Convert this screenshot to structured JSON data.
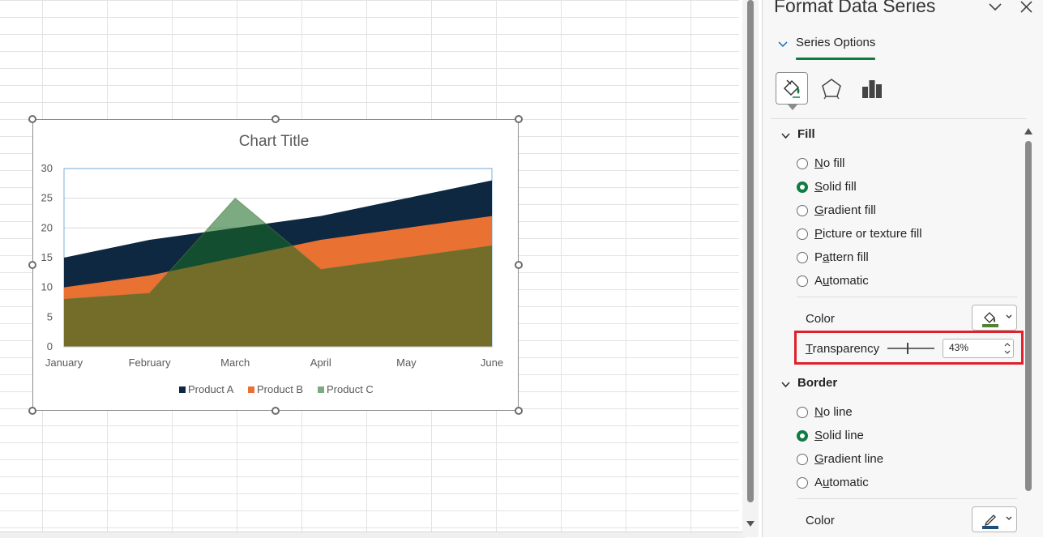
{
  "pane": {
    "title": "Format Data Series",
    "series_options_label": "Series Options",
    "icon_tabs": [
      "fill-line-icon",
      "effects-icon",
      "series-options-icon"
    ],
    "fill_section": {
      "label": "Fill",
      "options": [
        {
          "pre": "",
          "key": "N",
          "post": "o fill",
          "selected": false
        },
        {
          "pre": "",
          "key": "S",
          "post": "olid fill",
          "selected": true
        },
        {
          "pre": "",
          "key": "G",
          "post": "radient fill",
          "selected": false
        },
        {
          "pre": "",
          "key": "P",
          "post": "icture or texture fill",
          "selected": false
        },
        {
          "pre": "P",
          "key": "a",
          "post": "ttern fill",
          "selected": false
        },
        {
          "pre": "A",
          "key": "u",
          "post": "tomatic",
          "selected": false
        }
      ],
      "color_label": "Color",
      "transparency_label": "Transparency",
      "transparency_value": "43%",
      "transparency_fraction": 0.43,
      "color_swatch": "#548235"
    },
    "border_section": {
      "label": "Border",
      "options": [
        {
          "pre": "",
          "key": "N",
          "post": "o line",
          "selected": false
        },
        {
          "pre": "",
          "key": "S",
          "post": "olid line",
          "selected": true
        },
        {
          "pre": "",
          "key": "G",
          "post": "radient line",
          "selected": false
        },
        {
          "pre": "A",
          "key": "u",
          "post": "tomatic",
          "selected": false
        }
      ],
      "color_label": "Color",
      "color_swatch": "#1f4e79"
    }
  },
  "colors": {
    "accent": "#107c41",
    "highlight": "#e0202a"
  },
  "chart_data": {
    "type": "area",
    "title": "Chart Title",
    "categories": [
      "January",
      "February",
      "March",
      "April",
      "May",
      "June"
    ],
    "series": [
      {
        "name": "Product A",
        "values": [
          15,
          18,
          20,
          22,
          25,
          28
        ],
        "color": "#0e2841"
      },
      {
        "name": "Product B",
        "values": [
          10,
          12,
          15,
          18,
          20,
          22
        ],
        "color": "#e97132"
      },
      {
        "name": "Product C",
        "values": [
          8,
          9,
          25,
          13,
          15,
          17
        ],
        "color": "#196b24",
        "opacity": 0.57
      }
    ],
    "ylim": [
      0,
      30
    ],
    "yticks": [
      0,
      5,
      10,
      15,
      20,
      25,
      30
    ],
    "legend": "bottom",
    "xlabel": "",
    "ylabel": ""
  }
}
